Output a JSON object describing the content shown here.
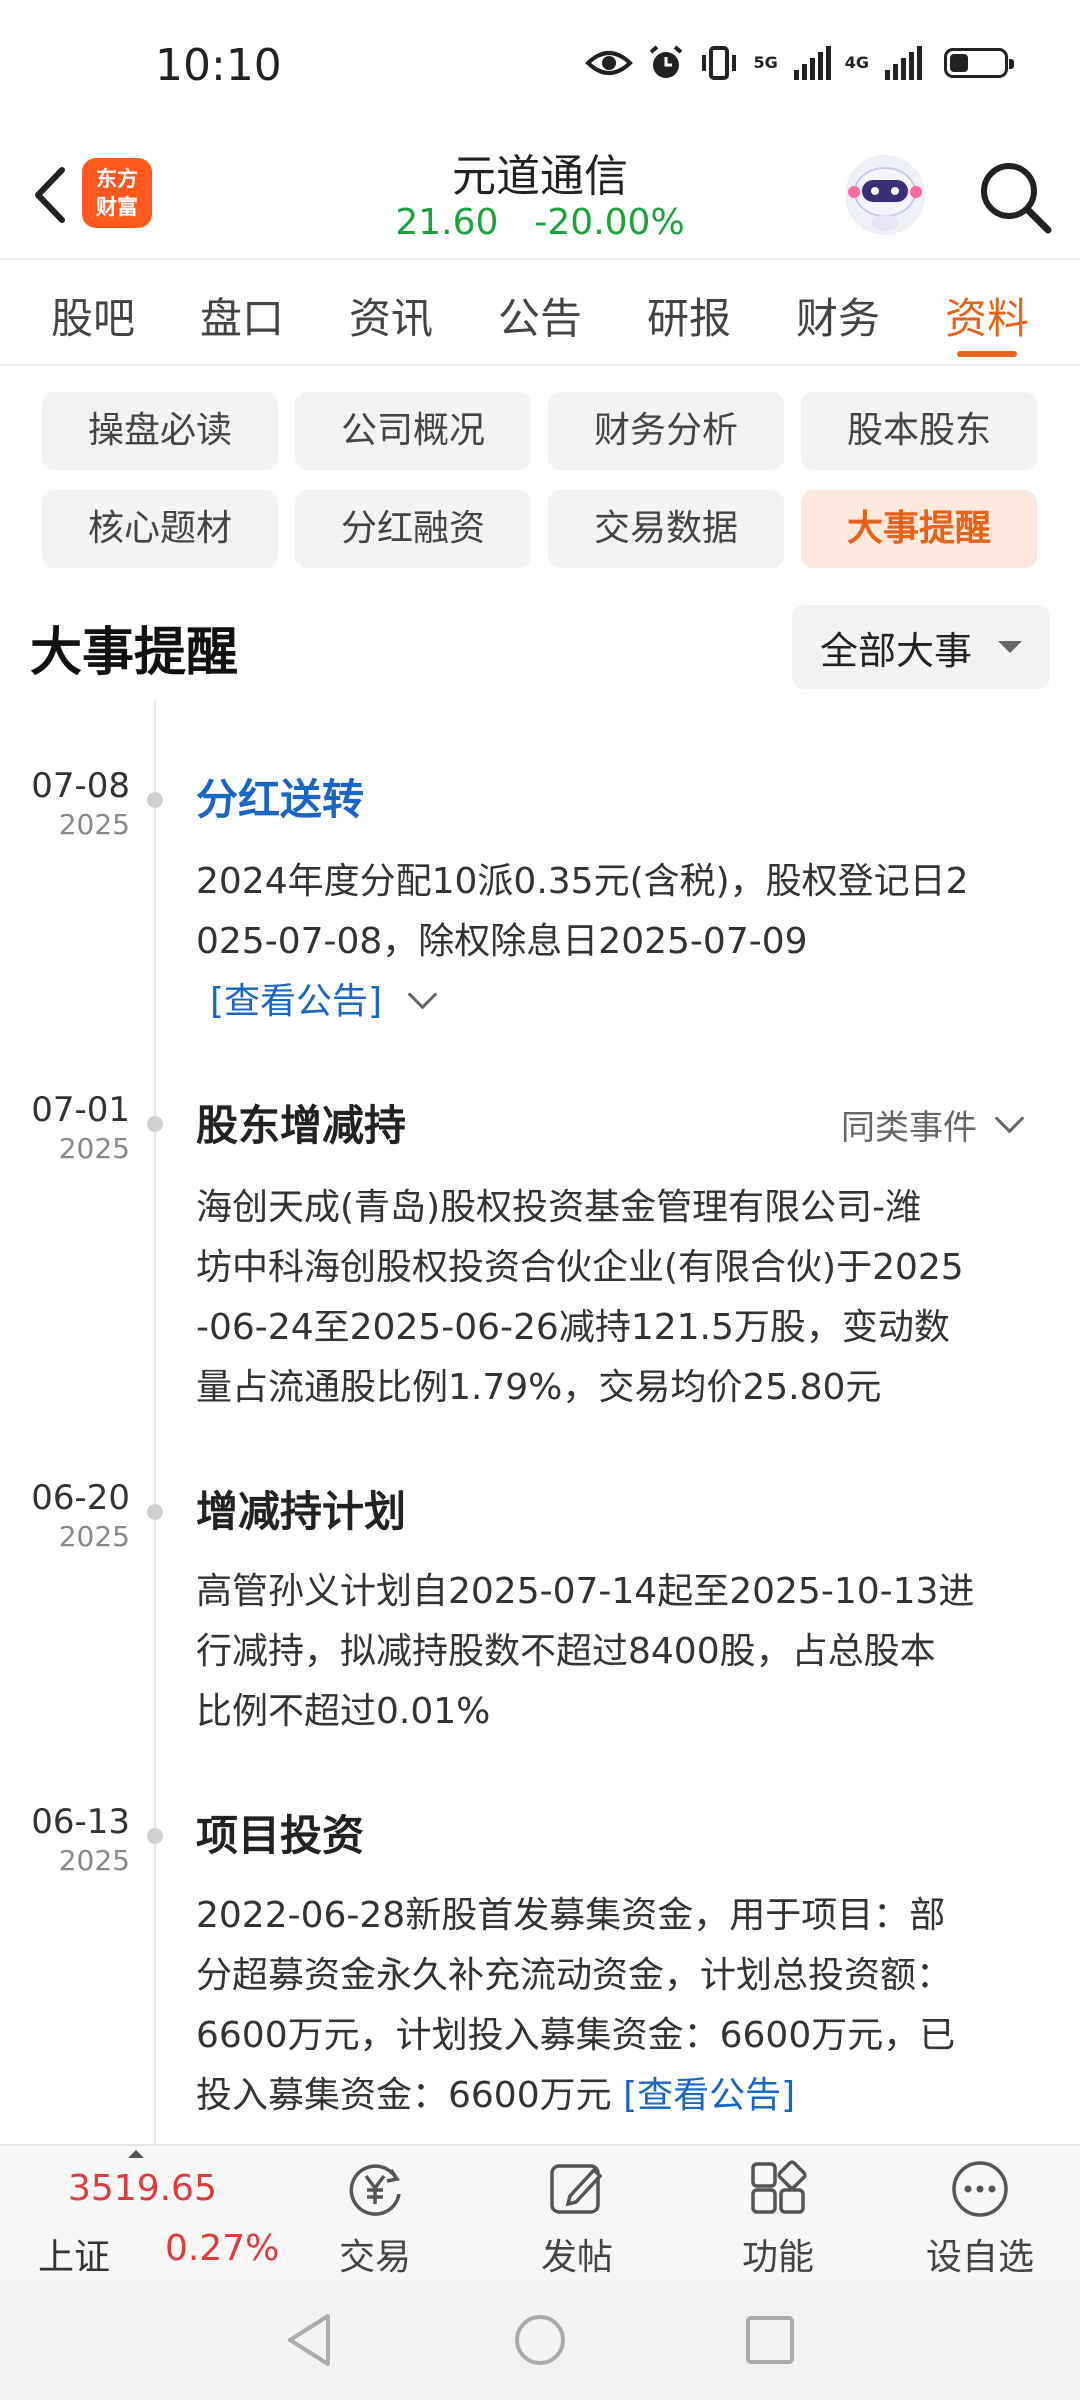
{
  "status_bar": {
    "time": "10:10",
    "net1": "5G",
    "net2": "4G",
    "battery_level": 0.35,
    "icons": [
      "eye-icon",
      "alarm-icon",
      "vibrate-icon",
      "signal-5g-icon",
      "signal-4g-icon",
      "battery-icon"
    ]
  },
  "header": {
    "logo_line1": "东方",
    "logo_line2": "财富",
    "stock_name": "元道通信",
    "price": "21.60",
    "change": "-20.00%",
    "price_color": "#1aa33b"
  },
  "tabs": [
    {
      "label": "股吧"
    },
    {
      "label": "盘口"
    },
    {
      "label": "资讯"
    },
    {
      "label": "公告"
    },
    {
      "label": "研报"
    },
    {
      "label": "财务"
    },
    {
      "label": "资料"
    }
  ],
  "active_tab": "资料",
  "chips": [
    {
      "label": "操盘必读"
    },
    {
      "label": "公司概况"
    },
    {
      "label": "财务分析"
    },
    {
      "label": "股本股东"
    },
    {
      "label": "核心题材"
    },
    {
      "label": "分红融资"
    },
    {
      "label": "交易数据"
    },
    {
      "label": "大事提醒"
    }
  ],
  "active_chip": "大事提醒",
  "section": {
    "title": "大事提醒",
    "filter_label": "全部大事"
  },
  "events": [
    {
      "date": "07-08",
      "year": "2025",
      "title": "分红送转",
      "desc_line1": "2024年度分配10派0.35元(含税)，股权登记日2",
      "desc_line2": "025-07-08，除权除息日2025-07-09",
      "link": "[查看公告]"
    },
    {
      "date": "07-01",
      "year": "2025",
      "title": "股东增减持",
      "similar": "同类事件",
      "desc_line1": "海创天成(青岛)股权投资基金管理有限公司-潍",
      "desc_line2": "坊中科海创股权投资合伙企业(有限合伙)于2025",
      "desc_line3": "-06-24至2025-06-26减持121.5万股，变动数",
      "desc_line4": "量占流通股比例1.79%，交易均价25.80元"
    },
    {
      "date": "06-20",
      "year": "2025",
      "title": "增减持计划",
      "desc_line1": "高管孙义计划自2025-07-14起至2025-10-13进",
      "desc_line2": "行减持，拟减持股数不超过8400股，占总股本",
      "desc_line3": "比例不超过0.01%"
    },
    {
      "date": "06-13",
      "year": "2025",
      "title": "项目投资",
      "desc_line1": "2022-06-28新股首发募集资金，用于项目：部",
      "desc_line2": "分超募资金永久补充流动资金，计划总投资额：",
      "desc_line3": "6600万元，计划投入募集资金：6600万元，已",
      "desc_line4": "投入募集资金：6600万元 ",
      "link": "[查看公告]"
    }
  ],
  "bottom_bar": {
    "index_value": "3519.65",
    "index_name": "上证",
    "index_change": "0.27%",
    "items": [
      {
        "label": "交易",
        "icon": "yuan-refresh-icon"
      },
      {
        "label": "发帖",
        "icon": "edit-post-icon"
      },
      {
        "label": "功能",
        "icon": "grid-apps-icon"
      },
      {
        "label": "设自选",
        "icon": "more-circle-icon"
      }
    ]
  }
}
